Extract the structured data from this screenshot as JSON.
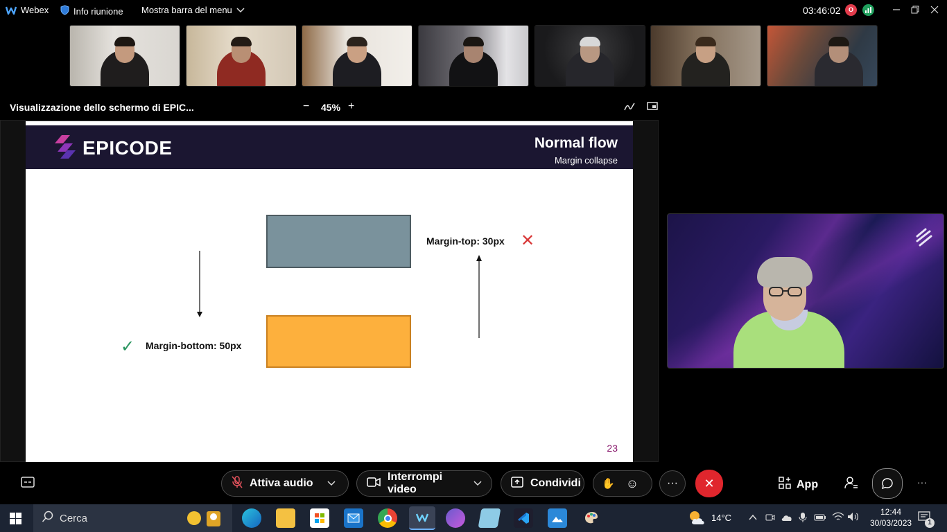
{
  "titlebar": {
    "app_name": "Webex",
    "info": "Info riunione",
    "menu_toggle": "Mostra barra del menu",
    "timer": "03:46:02",
    "record_badge": "O"
  },
  "sharebar": {
    "title": "Visualizzazione dello schermo di EPIC...",
    "zoom_minus": "−",
    "zoom": "45%",
    "zoom_plus": "+"
  },
  "slide": {
    "logo": "EPICODE",
    "title": "Normal flow",
    "subtitle": "Margin collapse",
    "label_top": "Margin-top: 30px",
    "label_bottom": "Margin-bottom: 50px",
    "mark_x": "✕",
    "mark_check": "✓",
    "page_number": "23"
  },
  "controls": {
    "chat_icon": "▭",
    "audio": "Attiva audio",
    "video": "Interrompi video",
    "share": "Condividi",
    "raise_hand": "✋",
    "reactions": "☺",
    "more": "···",
    "end": "✕",
    "apps": "App",
    "participants": "☺",
    "chat": "◯",
    "overflow": "···"
  },
  "taskbar": {
    "search": "Cerca",
    "weather": "14°C",
    "time": "12:44",
    "date": "30/03/2023",
    "notifications": "1"
  },
  "colors": {
    "accent_purple": "#1b1631",
    "end_call": "#e0262d",
    "grey_box": "#7a929c",
    "orange_box": "#fdb03d"
  }
}
